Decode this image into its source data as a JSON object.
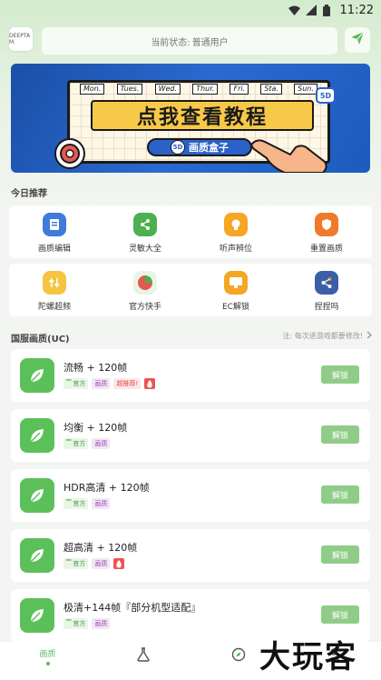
{
  "status_bar": {
    "time": "11:22"
  },
  "header": {
    "avatar_text": "DEEPTA M.",
    "status_label": "当前状态:",
    "status_value": "普通用户"
  },
  "banner": {
    "days": [
      "Mon.",
      "Tues.",
      "Wed.",
      "Thur.",
      "Fri.",
      "Sta.",
      "Sun."
    ],
    "title": "点我查看教程",
    "subtitle": "画质盒子",
    "badge": "5D"
  },
  "today_section": {
    "title": "今日推荐"
  },
  "grid_row1": [
    {
      "label": "画质编辑",
      "icon": "edit-doc-icon",
      "color": "#3f7bd9"
    },
    {
      "label": "灵敏大全",
      "icon": "share-icon",
      "color": "#4caf50"
    },
    {
      "label": "听声辨位",
      "icon": "bulb-icon",
      "color": "#f5a623"
    },
    {
      "label": "重置画质",
      "icon": "shield-icon",
      "color": "#f07a2a"
    }
  ],
  "grid_row2": [
    {
      "label": "陀螺超频",
      "icon": "sliders-icon",
      "color": "#f5c542"
    },
    {
      "label": "官方快手",
      "icon": "pie-icon",
      "color": "#4caf50"
    },
    {
      "label": "EC解锁",
      "icon": "monitor-icon",
      "color": "#f5a623"
    },
    {
      "label": "捏捏吗",
      "icon": "share-node-icon",
      "color": "#3a5fa8"
    }
  ],
  "uc_section": {
    "title": "国服画质(UC)",
    "note": "注: 每次进游戏都要修改!"
  },
  "modes": [
    {
      "title": "流畅 + 120帧",
      "tags": [
        "官方",
        "画质",
        "超推荐!"
      ],
      "fire": true,
      "button": "解锁"
    },
    {
      "title": "均衡 + 120帧",
      "tags": [
        "官方",
        "画质"
      ],
      "fire": false,
      "button": "解锁"
    },
    {
      "title": "HDR高清 + 120帧",
      "tags": [
        "官方",
        "画质"
      ],
      "fire": false,
      "button": "解锁"
    },
    {
      "title": "超高清 + 120帧",
      "tags": [
        "官方",
        "画质"
      ],
      "fire": true,
      "button": "解锁"
    },
    {
      "title": "极清+144帧『部分机型适配』",
      "tags": [
        "官方",
        "画质"
      ],
      "fire": false,
      "button": "解锁"
    }
  ],
  "bottom_nav": {
    "home_label": "画质"
  },
  "watermark": "大玩客",
  "colors": {
    "accent": "#5cb85c",
    "unlock": "#8fcc88"
  }
}
